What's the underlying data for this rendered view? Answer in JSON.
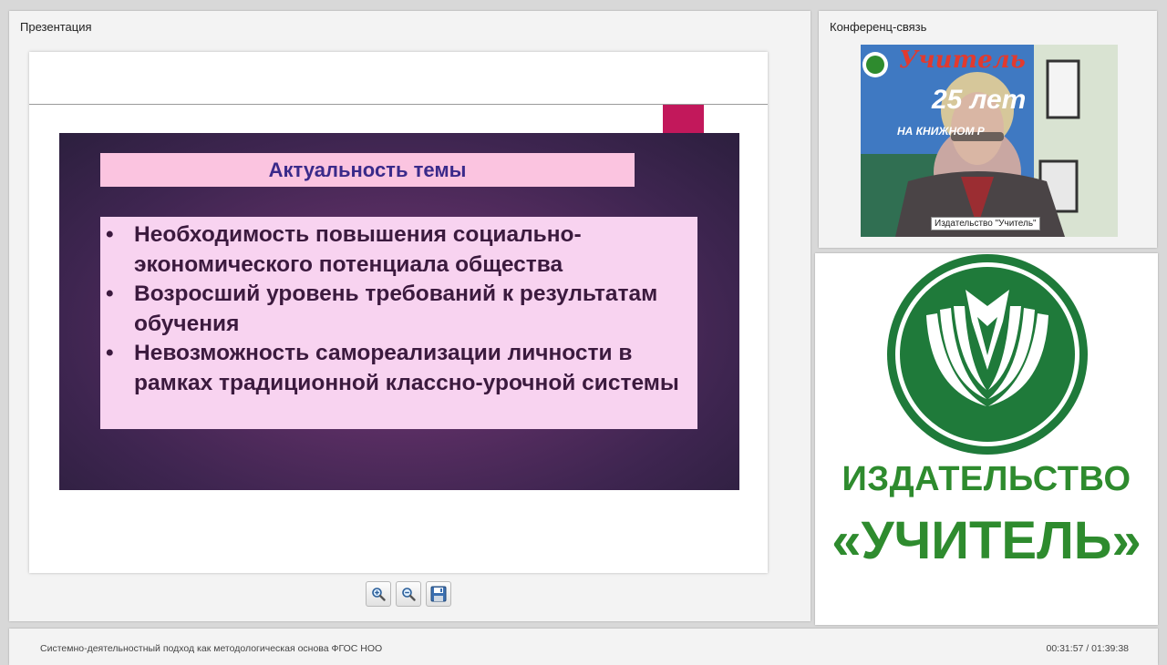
{
  "presentation": {
    "title": "Презентация",
    "slide": {
      "heading": "Актуальность темы",
      "bullets": [
        "Необходимость повышения социально-экономического потенциала общества",
        "Возросший уровень требований к результатам обучения",
        "Невозможность самореализации личности в рамках традиционной классно-урочной системы"
      ]
    },
    "toolbar": [
      {
        "icon": "zoom-in-icon"
      },
      {
        "icon": "zoom-out-icon"
      },
      {
        "icon": "save-icon"
      }
    ]
  },
  "conference": {
    "title": "Конференц-связь",
    "video_caption": "Издательство \"Учитель\"",
    "banner": {
      "brand": "Учитель",
      "years": "25 лет",
      "subline": "НА КНИЖНОМ Р"
    }
  },
  "logo": {
    "line1": "ИЗДАТЕЛЬСТВО",
    "line2": "«УЧИТЕЛЬ»",
    "color": "#2e8b2e"
  },
  "footer": {
    "lecture_title": "Системно-деятельностный подход как методологическая основа ФГОС НОО",
    "time": "00:31:57 / 01:39:38"
  },
  "colors": {
    "slide_accent": "#c2185b",
    "slide_title_bg": "#fbc4e0",
    "slide_title_text": "#3a2a8a",
    "slide_bullets_bg": "#f8d3f0"
  }
}
